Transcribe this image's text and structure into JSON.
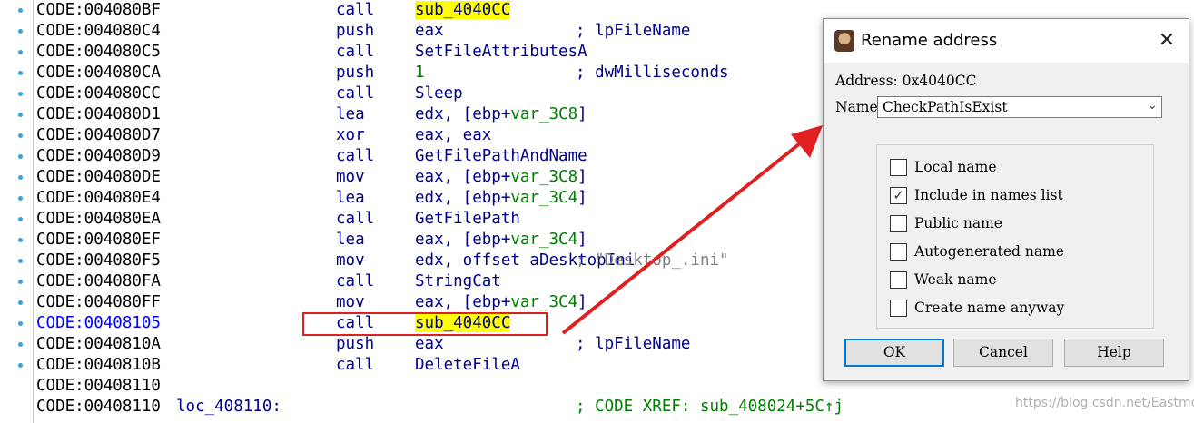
{
  "listing": [
    {
      "addr": "CODE:004080BF",
      "label": "",
      "mnem": "call",
      "ops": [
        {
          "t": "sub_4040CC",
          "k": "hl"
        }
      ],
      "cmt": ""
    },
    {
      "addr": "CODE:004080C4",
      "label": "",
      "mnem": "push",
      "ops": [
        {
          "t": "eax",
          "k": "tok"
        }
      ],
      "cmt": "; lpFileName"
    },
    {
      "addr": "CODE:004080C5",
      "label": "",
      "mnem": "call",
      "ops": [
        {
          "t": "SetFileAttributesA",
          "k": "tok"
        }
      ],
      "cmt": ""
    },
    {
      "addr": "CODE:004080CA",
      "label": "",
      "mnem": "push",
      "ops": [
        {
          "t": "1",
          "k": "imm"
        }
      ],
      "cmt": "; dwMilliseconds"
    },
    {
      "addr": "CODE:004080CC",
      "label": "",
      "mnem": "call",
      "ops": [
        {
          "t": "Sleep",
          "k": "tok"
        }
      ],
      "cmt": ""
    },
    {
      "addr": "CODE:004080D1",
      "label": "",
      "mnem": "lea",
      "ops": [
        {
          "t": "edx, [ebp+",
          "k": "tok"
        },
        {
          "t": "var_3C8",
          "k": "var"
        },
        {
          "t": "]",
          "k": "tok"
        }
      ],
      "cmt": ""
    },
    {
      "addr": "CODE:004080D7",
      "label": "",
      "mnem": "xor",
      "ops": [
        {
          "t": "eax, eax",
          "k": "tok"
        }
      ],
      "cmt": ""
    },
    {
      "addr": "CODE:004080D9",
      "label": "",
      "mnem": "call",
      "ops": [
        {
          "t": "GetFilePathAndName",
          "k": "tok"
        }
      ],
      "cmt": ""
    },
    {
      "addr": "CODE:004080DE",
      "label": "",
      "mnem": "mov",
      "ops": [
        {
          "t": "eax, [ebp+",
          "k": "tok"
        },
        {
          "t": "var_3C8",
          "k": "var"
        },
        {
          "t": "]",
          "k": "tok"
        }
      ],
      "cmt": ""
    },
    {
      "addr": "CODE:004080E4",
      "label": "",
      "mnem": "lea",
      "ops": [
        {
          "t": "edx, [ebp+",
          "k": "tok"
        },
        {
          "t": "var_3C4",
          "k": "var"
        },
        {
          "t": "]",
          "k": "tok"
        }
      ],
      "cmt": ""
    },
    {
      "addr": "CODE:004080EA",
      "label": "",
      "mnem": "call",
      "ops": [
        {
          "t": "GetFilePath",
          "k": "tok"
        }
      ],
      "cmt": ""
    },
    {
      "addr": "CODE:004080EF",
      "label": "",
      "mnem": "lea",
      "ops": [
        {
          "t": "eax, [ebp+",
          "k": "tok"
        },
        {
          "t": "var_3C4",
          "k": "var"
        },
        {
          "t": "]",
          "k": "tok"
        }
      ],
      "cmt": ""
    },
    {
      "addr": "CODE:004080F5",
      "label": "",
      "mnem": "mov",
      "ops": [
        {
          "t": "edx, offset aDesktopIni",
          "k": "tok"
        }
      ],
      "cmt": "; \"Desktop_.ini\""
    },
    {
      "addr": "CODE:004080FA",
      "label": "",
      "mnem": "call",
      "ops": [
        {
          "t": "StringCat",
          "k": "tok"
        }
      ],
      "cmt": ""
    },
    {
      "addr": "CODE:004080FF",
      "label": "",
      "mnem": "mov",
      "ops": [
        {
          "t": "eax, [ebp+",
          "k": "tok"
        },
        {
          "t": "var_3C4",
          "k": "var"
        },
        {
          "t": "]",
          "k": "tok"
        }
      ],
      "cmt": ""
    },
    {
      "addr": "CODE:00408105",
      "label": "",
      "mnem": "call",
      "ops": [
        {
          "t": "sub_4040CC",
          "k": "hl"
        }
      ],
      "cmt": "",
      "current": true
    },
    {
      "addr": "CODE:0040810A",
      "label": "",
      "mnem": "push",
      "ops": [
        {
          "t": "eax",
          "k": "tok"
        }
      ],
      "cmt": "; lpFileName"
    },
    {
      "addr": "CODE:0040810B",
      "label": "",
      "mnem": "call",
      "ops": [
        {
          "t": "DeleteFileA",
          "k": "tok"
        }
      ],
      "cmt": ""
    },
    {
      "addr": "CODE:00408110",
      "label": "",
      "mnem": "",
      "ops": [],
      "cmt": ""
    },
    {
      "addr": "CODE:00408110",
      "label": "loc_408110:",
      "mnem": "",
      "ops": [],
      "cmt": "; CODE XREF: sub_408024+5C↑j"
    }
  ],
  "dialog": {
    "title": "Rename address",
    "close_glyph": "✕",
    "address_label": "Address: 0x4040CC",
    "name_label": "Name",
    "name_value": "CheckPathIsExist",
    "combo_glyph": "⌄",
    "options": [
      {
        "label": "Local name",
        "checked": false
      },
      {
        "label": "Include in names list",
        "checked": true
      },
      {
        "label": "Public name",
        "checked": false
      },
      {
        "label": "Autogenerated name",
        "checked": false
      },
      {
        "label": "Weak name",
        "checked": false
      },
      {
        "label": "Create name anyway",
        "checked": false
      }
    ],
    "buttons": {
      "ok": "OK",
      "cancel": "Cancel",
      "help": "Help"
    }
  },
  "watermark": "https://blog.csdn.net/Eastmount",
  "colors": {
    "highlight": "#ffff00",
    "annotation": "#e02020",
    "accent": "#0078d7"
  },
  "icons": {
    "app": "ida-app-icon",
    "close": "close-icon",
    "combo": "chevron-down-icon",
    "check": "checkmark-icon"
  }
}
